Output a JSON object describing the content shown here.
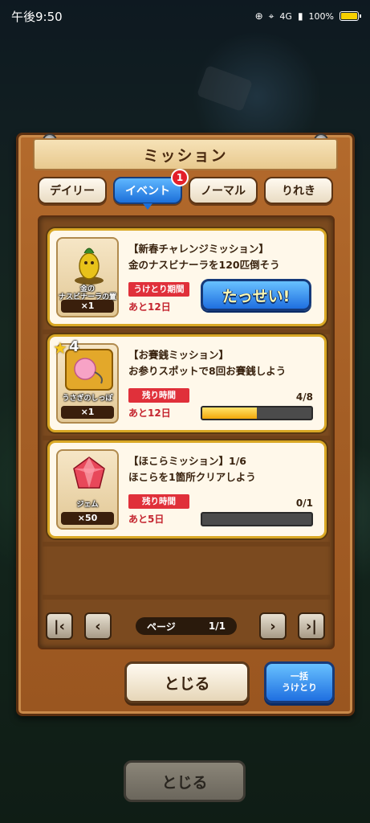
{
  "statusbar": {
    "time": "午後9:50",
    "network": "4G",
    "battery": "100%"
  },
  "panel": {
    "title": "ミッション"
  },
  "tabs": [
    {
      "label": "デイリー",
      "active": false
    },
    {
      "label": "イベント",
      "active": true,
      "badge": "1"
    },
    {
      "label": "ノーマル",
      "active": false
    },
    {
      "label": "りれき",
      "active": false
    }
  ],
  "missions": [
    {
      "title": "【新春チャレンジミッション】",
      "description": "金のナスビナーラを120匹倒そう",
      "reward_name_line1": "金の",
      "reward_name_line2": "ナスビナーラの置物",
      "reward_qty": "×1",
      "label": "うけとり期間",
      "remaining": "あと12日",
      "action": "たっせい!"
    },
    {
      "title": "【お賽銭ミッション】",
      "description": "お参りスポットで8回お賽銭しよう",
      "reward_name": "うさぎのしっぽ",
      "reward_stars": "4",
      "reward_qty": "×1",
      "label": "残り時間",
      "remaining": "あと12日",
      "progress": "4/8",
      "progress_fraction": 0.5
    },
    {
      "title": "【ほこらミッション】1/6",
      "description": "ほこらを1箇所クリアしよう",
      "reward_name": "ジェム",
      "reward_qty": "×50",
      "label": "残り時間",
      "remaining": "あと5日",
      "progress": "0/1",
      "progress_fraction": 0
    }
  ],
  "pager": {
    "label": "ページ",
    "value": "1/1"
  },
  "buttons": {
    "close": "とじる",
    "bulk_line1": "一括",
    "bulk_line2": "うけとり",
    "background_close": "とじる"
  },
  "colors": {
    "accent_blue": "#1f6fe0",
    "card_border_gold": "#d9a825",
    "label_red": "#e0303a"
  }
}
